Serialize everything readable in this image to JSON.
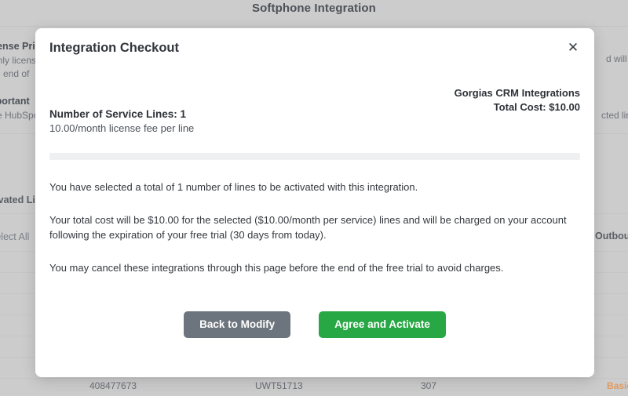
{
  "background": {
    "page_title": "Softphone Integration",
    "notes": [
      {
        "heading": "License Pricing",
        "lines": [
          "Monthly license fee per line",
          "the end of"
        ]
      },
      {
        "heading": "Important",
        "lines": [
          "the HubSpot"
        ]
      }
    ],
    "right_fragments": [
      "d will be",
      "cted lines"
    ],
    "table": {
      "columns": [
        "Activated Lines",
        "Outbound"
      ],
      "select_all_label": "Select All",
      "row": {
        "account": "408477673",
        "device": "UWT51713",
        "extension": "307",
        "plan": "Basic"
      }
    }
  },
  "modal": {
    "title": "Integration Checkout",
    "close_icon": "close-icon",
    "close_label": "✕",
    "summary": {
      "integration_name": "Gorgias CRM Integrations",
      "total_cost": "Total Cost: $10.00"
    },
    "lines": {
      "count_label": "Number of Service Lines: 1",
      "fee_label": "10.00/month license fee per line"
    },
    "paragraphs": [
      "You have selected a total of 1 number of lines to be activated with this integration.",
      "Your total cost will be $10.00 for the selected ($10.00/month per service) lines and will be charged on your account following the expiration of your free trial (30 days from today).",
      "You may cancel these integrations through this page before the end of the free trial to avoid charges."
    ],
    "buttons": {
      "back_label": "Back to Modify",
      "agree_label": "Agree and Activate"
    }
  },
  "colors": {
    "primary_green": "#28a745",
    "secondary_gray": "#6c757d",
    "overlay_gray": "#cccccc",
    "accent_orange": "#e09a5e",
    "progress_track": "#eef0f2"
  }
}
